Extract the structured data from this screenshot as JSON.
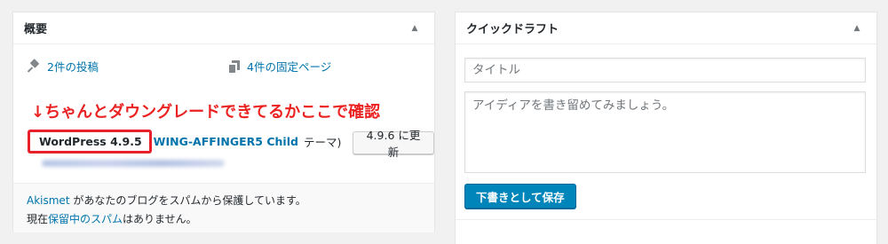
{
  "glance": {
    "title": "概要",
    "posts_label": "2件の投稿",
    "pages_label": "4件の固定ページ",
    "annotation": "↓ちゃんとダウングレードできてるかここで確認",
    "wp_version": "WordPress 4.9.5",
    "theme_name": "WING-AFFINGER5 Child",
    "theme_suffix": "テーマ)",
    "update_button": "4.9.6 に更新",
    "akismet_link": "Akismet",
    "akismet_text": " があなたのブログをスパムから保護しています。",
    "spam_prefix": "現在",
    "spam_link": "保留中のスパム",
    "spam_suffix": "はありません。"
  },
  "quick_draft": {
    "title": "クイックドラフト",
    "title_placeholder": "タイトル",
    "content_placeholder": "アイディアを書き留めてみましょう。",
    "save_button": "下書きとして保存"
  },
  "icons": {
    "toggle": "arrow-up-icon",
    "posts": "pushpin-icon",
    "pages": "pages-icon"
  },
  "colors": {
    "link": "#0073aa",
    "annotation": "#ea2222",
    "primary_button": "#0085ba"
  }
}
